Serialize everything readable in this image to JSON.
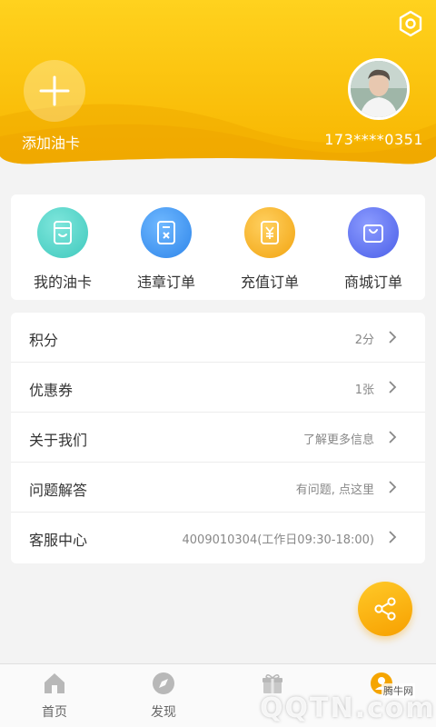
{
  "header": {
    "add_card_label": "添加油卡",
    "phone": "173****0351",
    "brand_color": "#f5b800"
  },
  "quick_menu": [
    {
      "label": "我的油卡",
      "icon": "card-icon",
      "color": "#47d3c9"
    },
    {
      "label": "违章订单",
      "icon": "violation-order-icon",
      "color": "#3d96f0"
    },
    {
      "label": "充值订单",
      "icon": "recharge-order-icon",
      "color": "#f5ae1e"
    },
    {
      "label": "商城订单",
      "icon": "shopping-bag-icon",
      "color": "#5a6ff0"
    }
  ],
  "list": [
    {
      "label": "积分",
      "value": "2分"
    },
    {
      "label": "优惠券",
      "value": "1张"
    },
    {
      "label": "关于我们",
      "value": "了解更多信息"
    },
    {
      "label": "问题解答",
      "value": "有问题, 点这里"
    },
    {
      "label": "客服中心",
      "value": "4009010304(工作日09:30-18:00)"
    }
  ],
  "bottom_nav": [
    {
      "label": "首页",
      "icon": "home-icon"
    },
    {
      "label": "发现",
      "icon": "compass-icon"
    },
    {
      "label": "",
      "icon": "gift-icon"
    },
    {
      "label": "",
      "icon": "user-icon"
    }
  ],
  "watermark": {
    "small": "腾牛网",
    "large": "QQTN.com"
  }
}
